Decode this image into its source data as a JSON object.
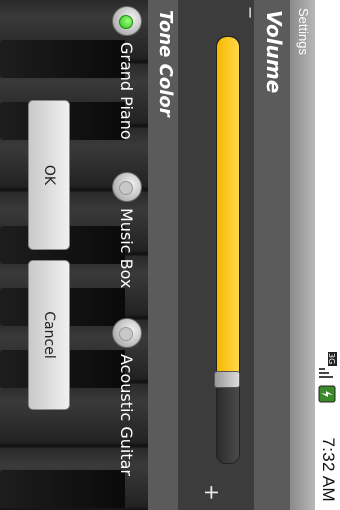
{
  "status_bar": {
    "network": "3G",
    "time": "7:32 AM"
  },
  "title_bar": {
    "title": "Settings"
  },
  "volume": {
    "header": "Volume",
    "minus_label": "−",
    "plus_label": "+",
    "level_fraction": 0.8
  },
  "tone_color": {
    "header": "Tone Color",
    "options": [
      {
        "label": "Grand Piano",
        "selected": true
      },
      {
        "label": "Music Box",
        "selected": false
      },
      {
        "label": "Acoustic Guitar",
        "selected": false
      }
    ]
  },
  "buttons": {
    "ok": "OK",
    "cancel": "Cancel"
  },
  "colors": {
    "slider_fill": "#f7b800",
    "selected_radio": "#2fc01a"
  }
}
